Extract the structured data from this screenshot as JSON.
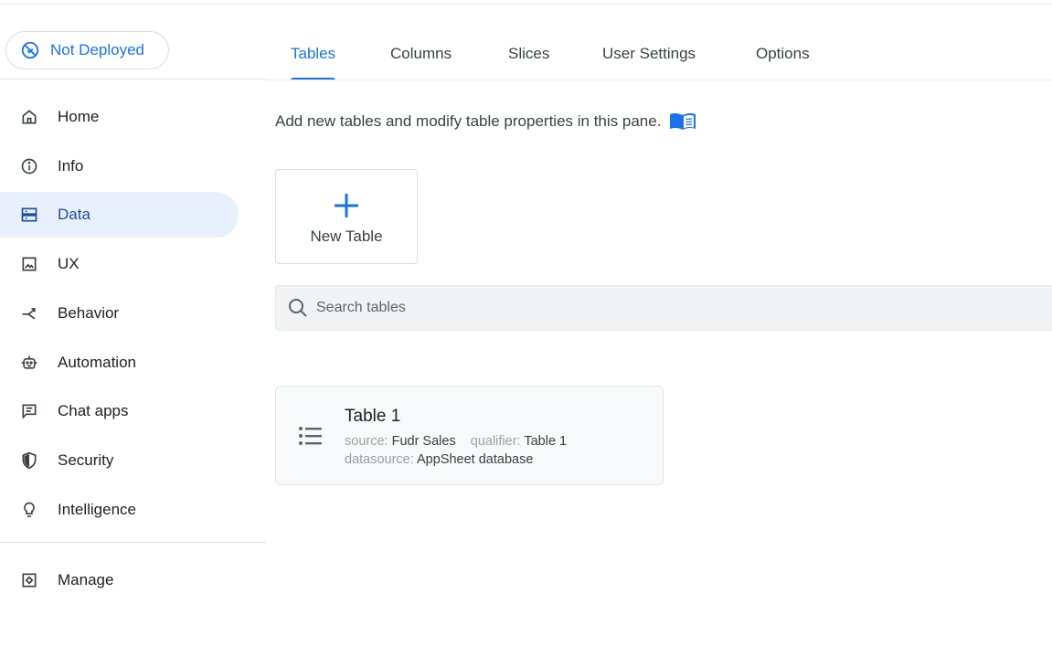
{
  "deploy_status": {
    "label": "Not Deployed",
    "icon": "not-deployed-icon"
  },
  "sidebar": {
    "items": [
      {
        "id": "home",
        "label": "Home",
        "icon": "home-icon",
        "active": false
      },
      {
        "id": "info",
        "label": "Info",
        "icon": "info-icon",
        "active": false
      },
      {
        "id": "data",
        "label": "Data",
        "icon": "data-icon",
        "active": true
      },
      {
        "id": "ux",
        "label": "UX",
        "icon": "image-icon",
        "active": false
      },
      {
        "id": "behavior",
        "label": "Behavior",
        "icon": "behavior-icon",
        "active": false
      },
      {
        "id": "automation",
        "label": "Automation",
        "icon": "robot-icon",
        "active": false
      },
      {
        "id": "chat-apps",
        "label": "Chat apps",
        "icon": "chat-icon",
        "active": false
      },
      {
        "id": "security",
        "label": "Security",
        "icon": "shield-icon",
        "active": false
      },
      {
        "id": "intelligence",
        "label": "Intelligence",
        "icon": "lightbulb-icon",
        "active": false
      }
    ],
    "footer_items": [
      {
        "id": "manage",
        "label": "Manage",
        "icon": "manage-icon",
        "active": false
      }
    ]
  },
  "tabs": [
    {
      "label": "Tables",
      "active": true
    },
    {
      "label": "Columns",
      "active": false
    },
    {
      "label": "Slices",
      "active": false
    },
    {
      "label": "User Settings",
      "active": false
    },
    {
      "label": "Options",
      "active": false
    }
  ],
  "main": {
    "description": "Add new tables and modify table properties in this pane.",
    "help_icon": "book-icon",
    "new_table": {
      "label": "New Table",
      "icon": "plus-icon"
    },
    "search": {
      "placeholder": "Search tables",
      "value": "",
      "icon": "search-icon"
    },
    "tables": [
      {
        "name": "Table 1",
        "icon": "list-icon",
        "meta": {
          "source_key": "source:",
          "source": "Fudr Sales",
          "qualifier_key": "qualifier:",
          "qualifier": "Table 1",
          "datasource_key": "datasource:",
          "datasource": "AppSheet database"
        }
      }
    ]
  },
  "colors": {
    "accent": "#1a73e8",
    "active_nav_bg": "#e8f0fe",
    "text": "#202124",
    "muted": "#9aa0a6"
  }
}
